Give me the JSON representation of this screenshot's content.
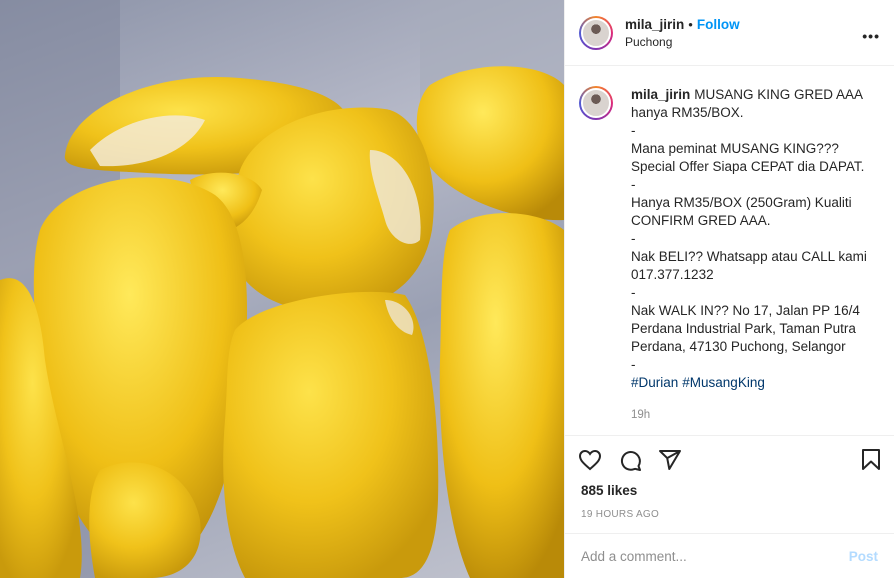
{
  "post": {
    "username": "mila_jirin",
    "follow_label": "Follow",
    "separator": "•",
    "location": "Puchong",
    "more_label": "•••"
  },
  "caption": {
    "username": "mila_jirin",
    "lines": [
      "MUSANG KING GRED AAA",
      "hanya RM35/BOX.",
      "-",
      "Mana peminat MUSANG KING???",
      "Special Offer Siapa CEPAT dia DAPAT.",
      "-",
      "Hanya RM35/BOX (250Gram) Kualiti",
      "CONFIRM GRED AAA.",
      "-",
      "Nak BELI?? Whatsapp atau CALL kami",
      "017.377.1232",
      "-",
      "Nak WALK IN?? No 17, Jalan PP 16/4",
      "Perdana Industrial Park, Taman Putra",
      "Perdana, 47130 Puchong, Selangor",
      "-"
    ],
    "hashtags": [
      "#Durian",
      "#MusangKing"
    ],
    "time": "19h"
  },
  "actions": {
    "like_icon": "heart-icon",
    "comment_icon": "comment-bubble-icon",
    "share_icon": "paper-plane-icon",
    "save_icon": "bookmark-icon"
  },
  "stats": {
    "likes": "885 likes",
    "time_ago": "19 HOURS AGO"
  },
  "comment_box": {
    "placeholder": "Add a comment...",
    "post_label": "Post"
  },
  "colors": {
    "link_blue": "#0095f6",
    "hashtag": "#00376b",
    "post_disabled": "#b3dbff",
    "durian_yellow": "#f2c417"
  },
  "image": {
    "subject": "durian-flesh-pieces-in-container"
  }
}
